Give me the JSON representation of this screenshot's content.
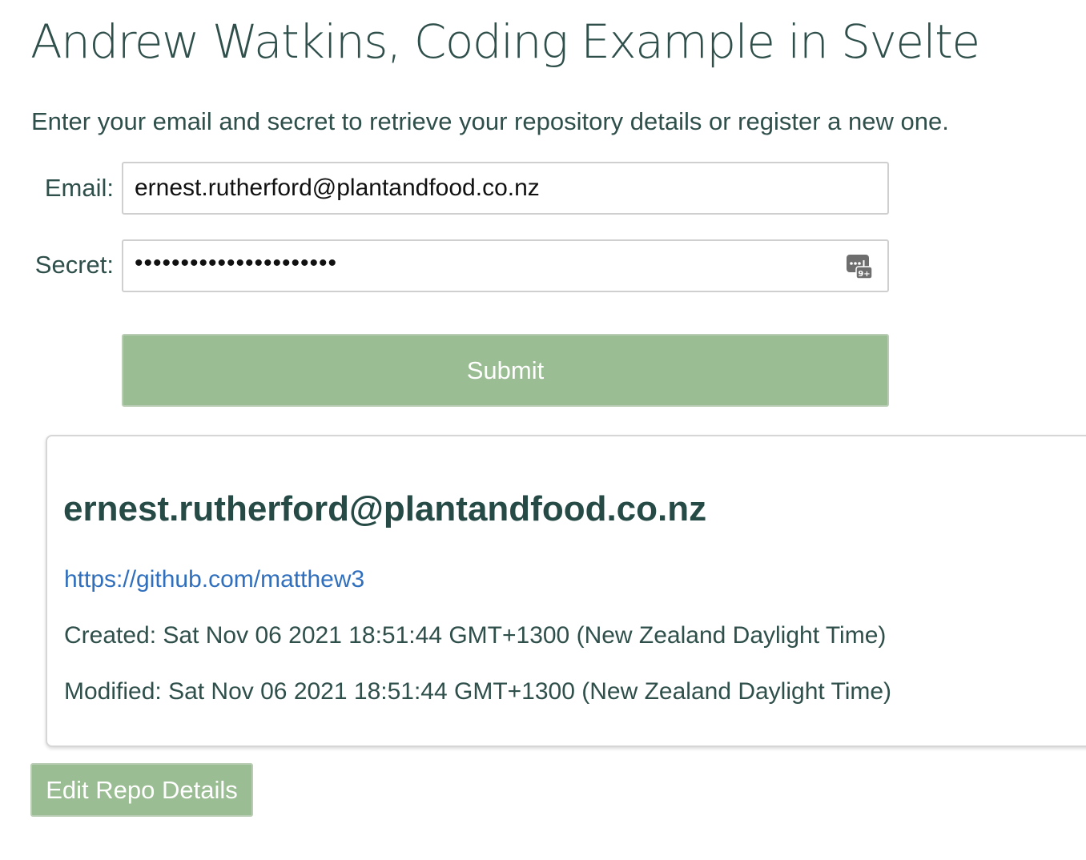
{
  "page": {
    "title": "Andrew Watkins, Coding Example in Svelte",
    "intro": "Enter your email and secret to retrieve your repository details or register a new one."
  },
  "form": {
    "email_label": "Email:",
    "email_value": "ernest.rutherford@plantandfood.co.nz",
    "secret_label": "Secret:",
    "secret_masked": "••••••••••••••••••••••",
    "password_icon": "password-autofill-icon",
    "password_icon_badge": "9+",
    "submit_label": "Submit"
  },
  "repo": {
    "email": "ernest.rutherford@plantandfood.co.nz",
    "url": "https://github.com/matthew3",
    "created": "Created: Sat Nov 06 2021 18:51:44 GMT+1300 (New Zealand Daylight Time)",
    "modified": "Modified: Sat Nov 06 2021 18:51:44 GMT+1300 (New Zealand Daylight Time)"
  },
  "actions": {
    "edit_label": "Edit Repo Details"
  },
  "colors": {
    "button_green": "#9bbd93",
    "heading_text": "#2f4f4b",
    "link_blue": "#2f6fbd"
  }
}
